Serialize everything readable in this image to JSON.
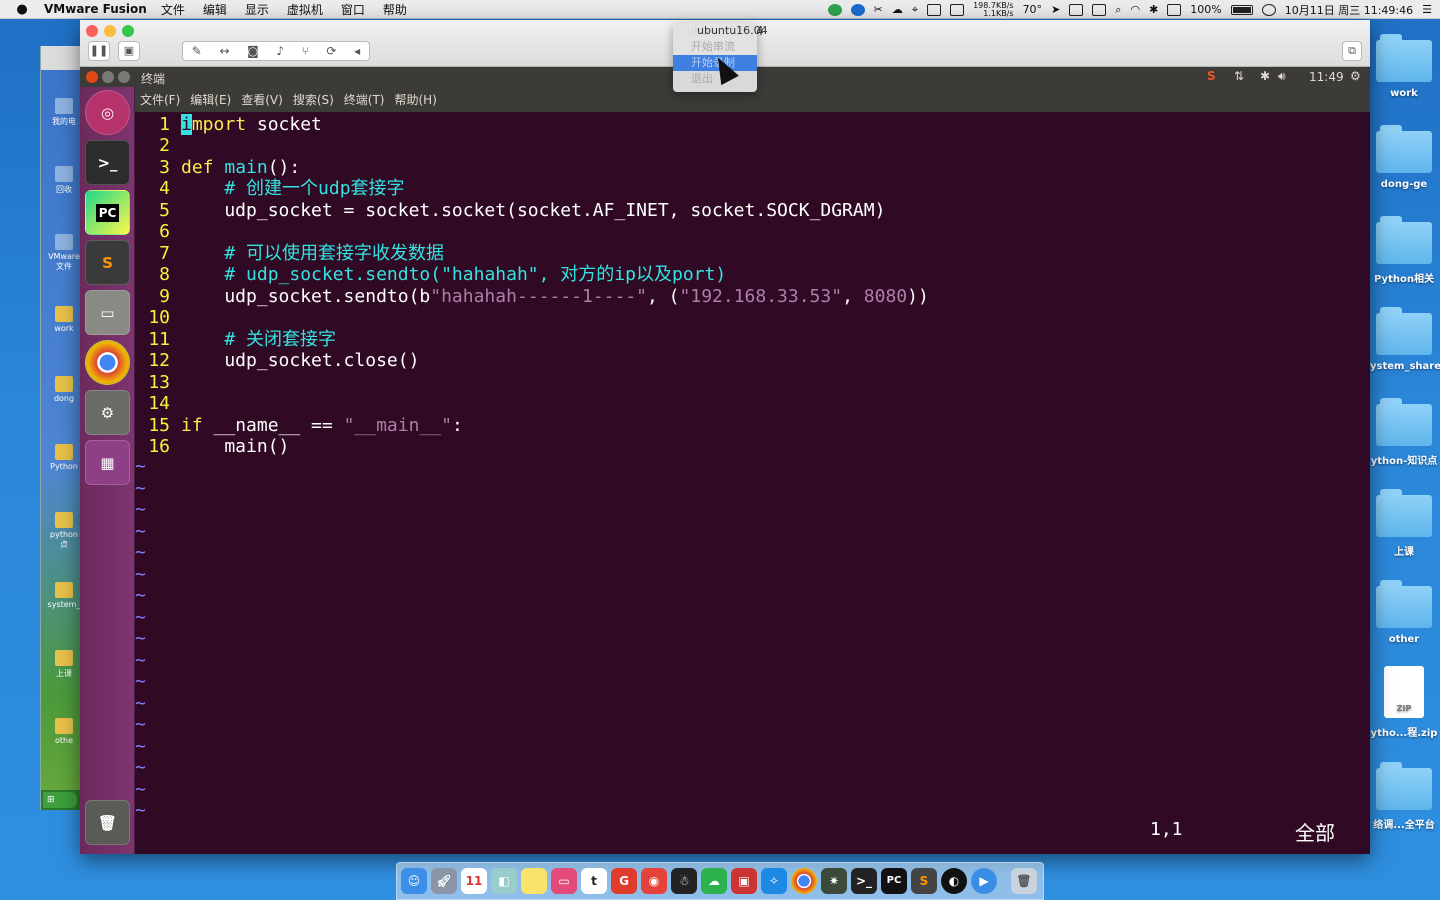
{
  "macbar": {
    "app_name": "VMware Fusion",
    "menus": [
      "文件",
      "编辑",
      "显示",
      "虚拟机",
      "窗口",
      "帮助"
    ],
    "net_up": "198.7KB/s",
    "net_down": "1.1KB/s",
    "temperature": "70°",
    "battery": "100%",
    "datetime": "10月11日 周三  11:49:46"
  },
  "xp_desktop": {
    "icons": [
      "我的电",
      "回收",
      "VMware 文件",
      "work",
      "dong",
      "Python",
      "python 点",
      "system_",
      "上课",
      "othe"
    ]
  },
  "right_desktop": {
    "icons": [
      "work",
      "dong-ge",
      "Python相关",
      "ystem_share",
      "ython-知识点",
      "上课",
      "other",
      "ytho...程.zip",
      "络调...全平台"
    ],
    "zip_label": "ZIP"
  },
  "vmware": {
    "window_title": "ubuntu16.04",
    "dropdown": [
      "ubuntu16.04",
      "开始串流",
      "开始录制",
      "退出"
    ]
  },
  "ubuntu": {
    "panel_title": "终端",
    "clock": "11:49",
    "launcher": [
      "ubuntu-dash",
      "terminal",
      "pycharm",
      "sublime-text",
      "file-archiver",
      "chrome",
      "system-settings",
      "workspace-switcher",
      "trash"
    ]
  },
  "terminal": {
    "menus": [
      "文件(F)",
      "编辑(E)",
      "查看(V)",
      "搜索(S)",
      "终端(T)",
      "帮助(H)"
    ],
    "lines": [
      {
        "n": "1",
        "text": "import socket"
      },
      {
        "n": "2",
        "text": ""
      },
      {
        "n": "3",
        "text": "def main():"
      },
      {
        "n": "4",
        "text": "    # 创建一个udp套接字"
      },
      {
        "n": "5",
        "text": "    udp_socket = socket.socket(socket.AF_INET, socket.SOCK_DGRAM)"
      },
      {
        "n": "6",
        "text": ""
      },
      {
        "n": "7",
        "text": "    # 可以使用套接字收发数据"
      },
      {
        "n": "8",
        "text": "    # udp_socket.sendto(\"hahahah\", 对方的ip以及port)"
      },
      {
        "n": "9",
        "text": "    udp_socket.sendto(b\"hahahah------1----\", (\"192.168.33.53\", 8080))"
      },
      {
        "n": "10",
        "text": ""
      },
      {
        "n": "11",
        "text": "    # 关闭套接字"
      },
      {
        "n": "12",
        "text": "    udp_socket.close()"
      },
      {
        "n": "13",
        "text": ""
      },
      {
        "n": "14",
        "text": ""
      },
      {
        "n": "15",
        "text": "if __name__ == \"__main__\":"
      },
      {
        "n": "16",
        "text": "    main()"
      }
    ],
    "status_position": "1,1",
    "status_scroll": "全部"
  }
}
